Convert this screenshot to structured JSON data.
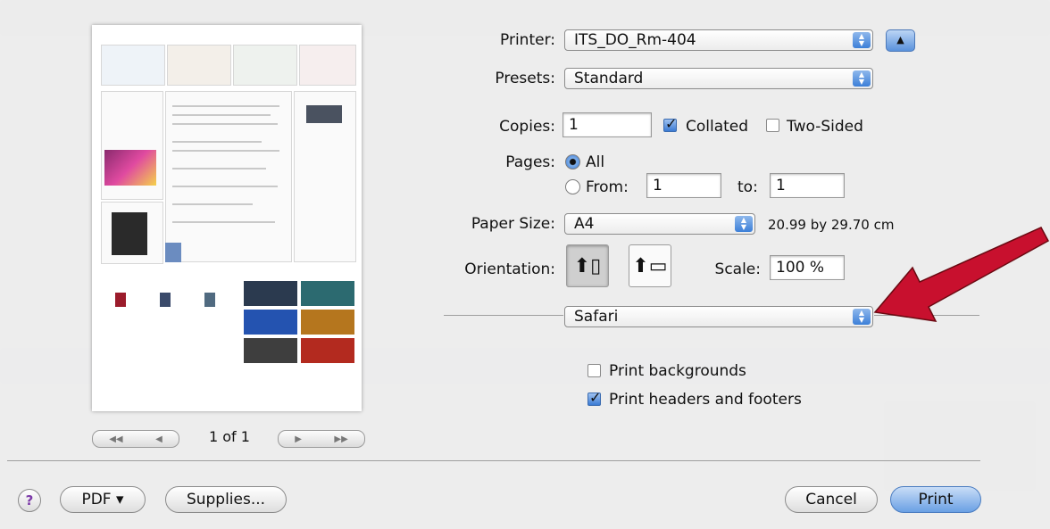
{
  "printer": {
    "label": "Printer:",
    "value": "ITS_DO_Rm-404"
  },
  "presets": {
    "label": "Presets:",
    "value": "Standard"
  },
  "copies": {
    "label": "Copies:",
    "value": "1",
    "collated_label": "Collated",
    "collated": true,
    "two_sided_label": "Two-Sided",
    "two_sided": false
  },
  "pages": {
    "label": "Pages:",
    "all_label": "All",
    "from_label": "From:",
    "from_value": "1",
    "to_label": "to:",
    "to_value": "1",
    "selected": "All"
  },
  "paper": {
    "label": "Paper Size:",
    "value": "A4",
    "dimensions": "20.99 by 29.70 cm"
  },
  "orientation": {
    "label": "Orientation:",
    "selected": "portrait"
  },
  "scale": {
    "label": "Scale:",
    "value": "100 %"
  },
  "section_popup": {
    "value": "Safari"
  },
  "safari_options": {
    "print_backgrounds_label": "Print backgrounds",
    "print_backgrounds": false,
    "headers_footers_label": "Print headers and footers",
    "headers_footers": true
  },
  "preview": {
    "page_count": "1 of 1"
  },
  "footer": {
    "help": "?",
    "pdf": "PDF ▾",
    "supplies": "Supplies...",
    "cancel": "Cancel",
    "print": "Print"
  },
  "colors": {
    "accent": "#3c7fd8",
    "annotation_arrow": "#c8102e"
  }
}
